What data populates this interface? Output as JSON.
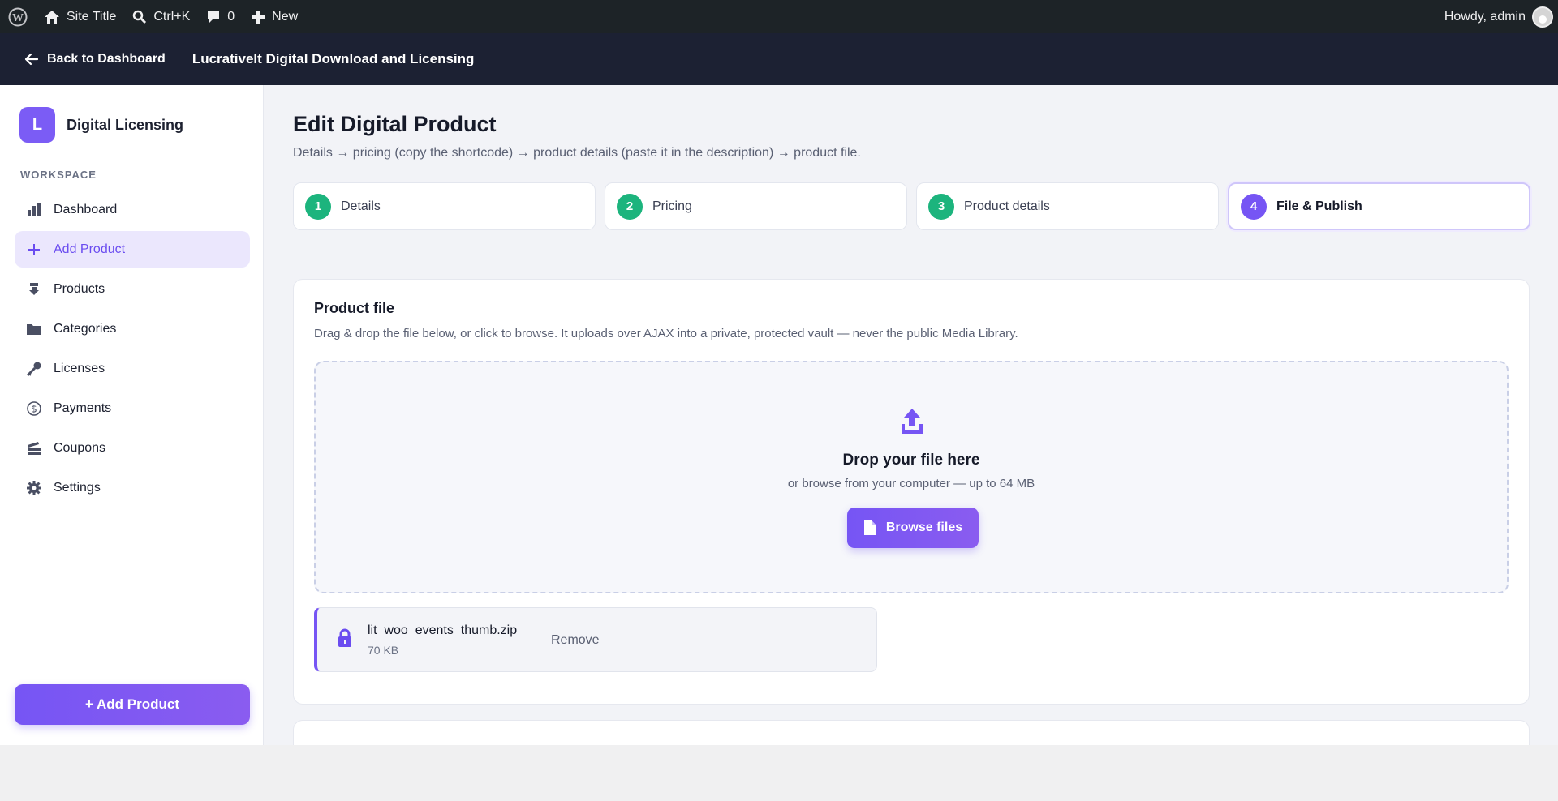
{
  "adminbar": {
    "site_title": "Site Title",
    "search_shortcut": "Ctrl+K",
    "comments_count": "0",
    "new_label": "New",
    "howdy": "Howdy, admin"
  },
  "topbar": {
    "back_label": "Back to Dashboard",
    "plugin_title": "LucrativeIt Digital Download and Licensing"
  },
  "sidebar": {
    "brand_letter": "L",
    "brand_name": "Digital Licensing",
    "section_label": "WORKSPACE",
    "items": [
      {
        "label": "Dashboard",
        "icon": "bar-chart-icon"
      },
      {
        "label": "Add Product",
        "icon": "plus-icon"
      },
      {
        "label": "Products",
        "icon": "download-icon"
      },
      {
        "label": "Categories",
        "icon": "folder-icon"
      },
      {
        "label": "Licenses",
        "icon": "key-icon"
      },
      {
        "label": "Payments",
        "icon": "dollar-icon"
      },
      {
        "label": "Coupons",
        "icon": "ticket-icon"
      },
      {
        "label": "Settings",
        "icon": "gear-icon"
      }
    ],
    "add_button": "+ Add Product"
  },
  "main": {
    "title": "Edit Digital Product",
    "subtitle": "Details → pricing (copy the shortcode) → product details (paste it in the description) → product file.",
    "steps": [
      {
        "num": "1",
        "label": "Details",
        "state": "done"
      },
      {
        "num": "2",
        "label": "Pricing",
        "state": "done"
      },
      {
        "num": "3",
        "label": "Product details",
        "state": "done"
      },
      {
        "num": "4",
        "label": "File & Publish",
        "state": "current"
      }
    ],
    "file_card": {
      "title": "Product file",
      "description": "Drag & drop the file below, or click to browse. It uploads over AJAX into a private, protected vault — never the public Media Library.",
      "drop_title": "Drop your file here",
      "drop_sub": "or browse from your computer — up to 64 MB",
      "browse_label": "Browse files",
      "file": {
        "name": "lit_woo_events_thumb.zip",
        "size": "70 KB",
        "remove_label": "Remove"
      }
    }
  },
  "colors": {
    "accent": "#7655f4",
    "done": "#1cb47d",
    "adminbar": "#1d2327",
    "topbar": "#1c2133"
  }
}
